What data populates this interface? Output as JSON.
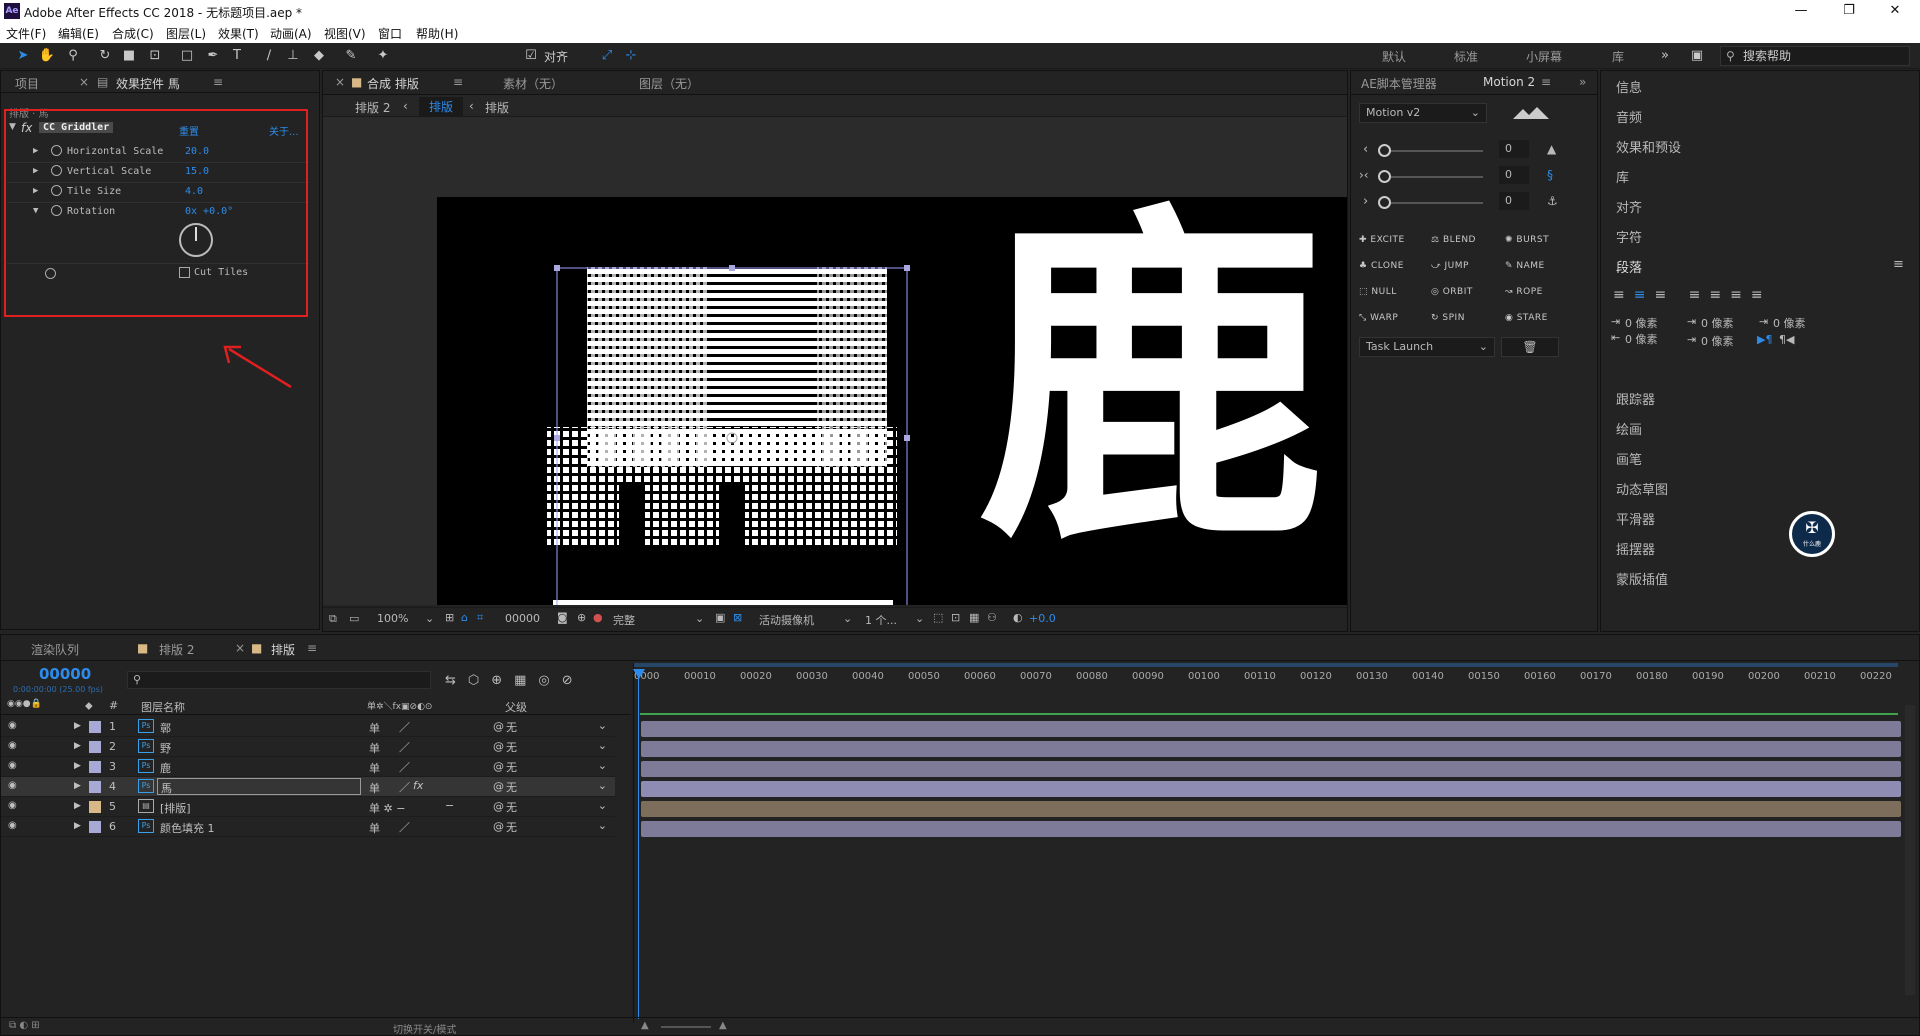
{
  "app": {
    "title": "Adobe After Effects CC 2018 - 无标题项目.aep *",
    "icon": "Ae",
    "minimize": "—",
    "maximize": "❐",
    "close": "✕"
  },
  "menu": [
    "文件(F)",
    "编辑(E)",
    "合成(C)",
    "图层(L)",
    "效果(T)",
    "动画(A)",
    "视图(V)",
    "窗口",
    "帮助(H)"
  ],
  "toolbar": {
    "snap_label": "对齐",
    "workspaces": [
      "默认",
      "标准",
      "小屏幕",
      "库"
    ],
    "search_placeholder": "搜索帮助"
  },
  "left_panel": {
    "tabs": [
      "项目",
      "效果控件 馬"
    ],
    "breadcrumb": "排版 · 馬",
    "effect": {
      "name": "CC Griddler",
      "reset": "重置",
      "about": "关于..."
    },
    "params": [
      {
        "name": "Horizontal Scale",
        "value": "20.0"
      },
      {
        "name": "Vertical Scale",
        "value": "15.0"
      },
      {
        "name": "Tile Size",
        "value": "4.0"
      },
      {
        "name": "Rotation",
        "value": "0x +0.0°"
      }
    ],
    "cut_tiles": "Cut Tiles"
  },
  "comp_panel": {
    "tabs": [
      "合成 排版",
      "素材（无）",
      "图层（无）"
    ],
    "flow": [
      "排版 2",
      "排版"
    ],
    "canvas_glyphs": [
      "鹿"
    ],
    "footer": {
      "zoom": "100%",
      "timecode": "00000",
      "resolution": "完整",
      "camera": "活动摄像机",
      "views": "1 个...",
      "exposure": "+0.0"
    }
  },
  "script_panel": {
    "tabs": [
      "AE脚本管理器",
      "Motion 2"
    ],
    "dropdown": "Motion v2",
    "sliders": [
      {
        "icon": "‹",
        "value": "0"
      },
      {
        "icon": "›‹",
        "value": "0"
      },
      {
        "icon": "›",
        "value": "0"
      }
    ],
    "buttons": [
      "EXCITE",
      "BLEND",
      "BURST",
      "CLONE",
      "JUMP",
      "NAME",
      "NULL",
      "ORBIT",
      "ROPE",
      "WARP",
      "SPIN",
      "STARE"
    ],
    "task": "Task Launch"
  },
  "right_panel": {
    "items_top": [
      "信息",
      "音频",
      "效果和预设",
      "库",
      "对齐",
      "字符"
    ],
    "paragraph": "段落",
    "px_label": "0 像素",
    "items_bottom": [
      "跟踪器",
      "绘画",
      "画笔",
      "动态草图",
      "平滑器",
      "摇摆器",
      "蒙版插值"
    ]
  },
  "timeline": {
    "tabs": [
      "渲染队列",
      "排版 2",
      "排版"
    ],
    "timecode": "00000",
    "fps": "0:00:00:00 (25.00 fps)",
    "search_placeholder": "",
    "header": {
      "num": "#",
      "layer_name": "图层名称",
      "parent": "父级"
    },
    "layers": [
      {
        "num": "1",
        "name": "鄣",
        "type": "Ps",
        "parent": "无",
        "color": "#a9a9d6"
      },
      {
        "num": "2",
        "name": "野",
        "type": "Ps",
        "parent": "无",
        "color": "#a9a9d6"
      },
      {
        "num": "3",
        "name": "鹿",
        "type": "Ps",
        "parent": "无",
        "color": "#a9a9d6"
      },
      {
        "num": "4",
        "name": "馬",
        "type": "Ps",
        "parent": "无",
        "color": "#a9a9d6"
      },
      {
        "num": "5",
        "name": "[排版]",
        "type": "comp",
        "parent": "无",
        "color": "#d8b887"
      },
      {
        "num": "6",
        "name": "颜色填充 1",
        "type": "Ps",
        "parent": "无",
        "color": "#a9a9d6"
      }
    ],
    "ruler": [
      "00010",
      "00020",
      "00030",
      "00040",
      "00050",
      "00060",
      "00070",
      "00080",
      "00090",
      "00100",
      "00110",
      "00120",
      "00130",
      "00140",
      "00150",
      "00160",
      "00170",
      "00180",
      "00190",
      "00200",
      "00210",
      "00220"
    ],
    "ruler_start": "0000",
    "footer_toggle": "切换开关/模式"
  },
  "colors": {
    "accent": "#2d8ceb",
    "highlight_box": "#e02020",
    "layer_bar": "#7d7b98",
    "comp_bar": "#7d6e5b",
    "work_area": "#3fa34d"
  },
  "watermark_text": "什么鹿"
}
